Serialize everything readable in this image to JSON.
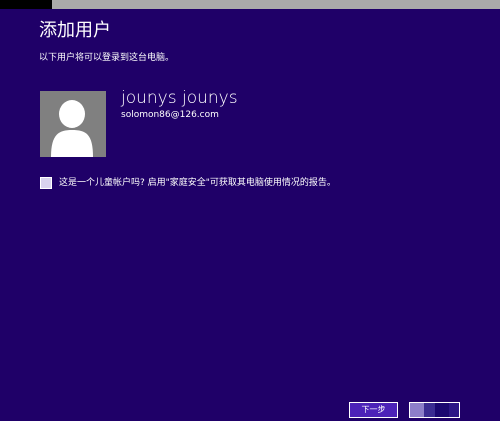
{
  "window": {
    "title": "添加用户"
  },
  "main": {
    "subtitle": "以下用户将可以登录到这台电脑。",
    "user": {
      "avatar_icon": "user-silhouette-icon",
      "name": "jounys jounys",
      "email": "solomon86@126.com"
    },
    "child_account": {
      "checked": false,
      "label": "这是一个儿童帐户吗? 启用\"家庭安全\"可获取其电脑使用情况的报告。"
    }
  },
  "footer": {
    "next_label": "下一步",
    "cancel_label": ""
  },
  "colors": {
    "background": "#1f0068",
    "accent_button": "#4c22b8",
    "top_bar": "#aaaaaa",
    "avatar_bg": "#808080"
  }
}
